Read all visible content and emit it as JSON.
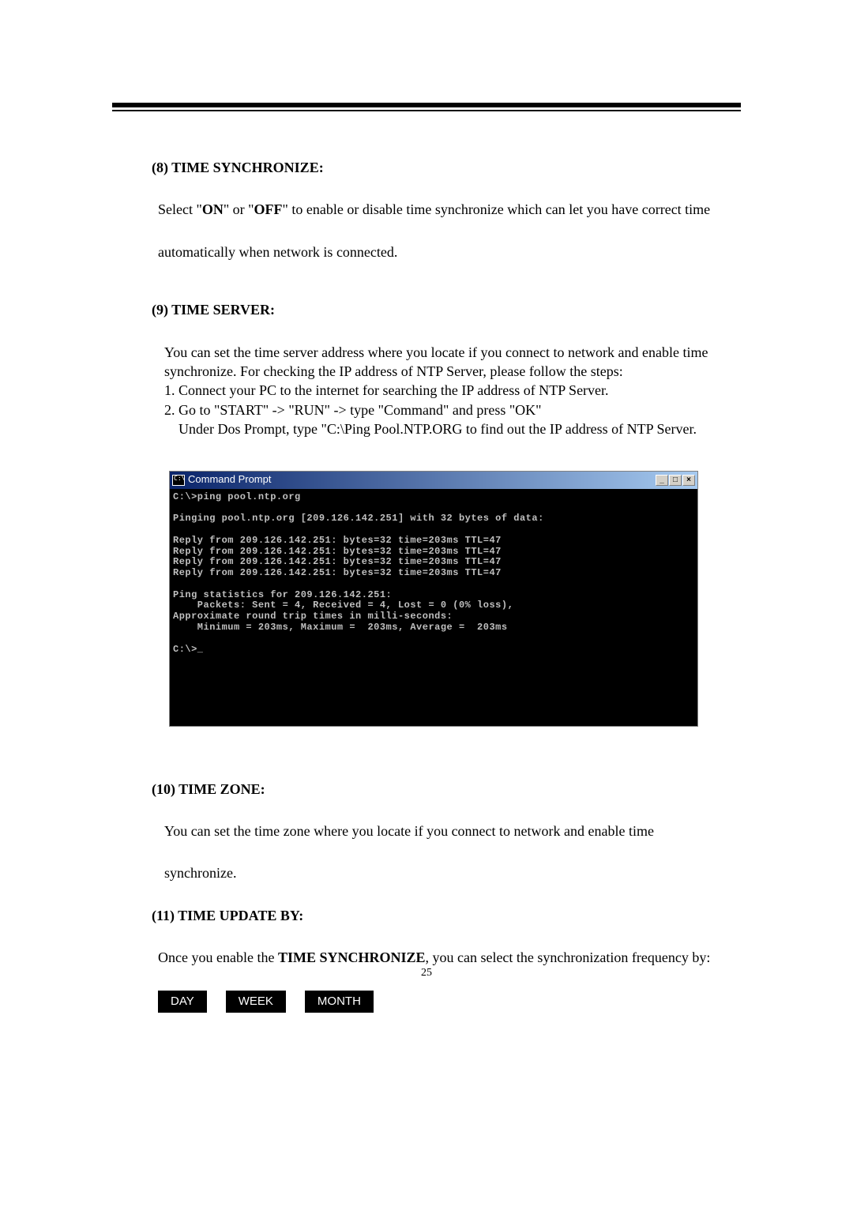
{
  "page_number": "25",
  "section8": {
    "heading": "(8) TIME SYNCHRONIZE:",
    "line1_pre": "Select \"",
    "on": "ON",
    "line1_mid": "\" or \"",
    "off": "OFF",
    "line1_post": "\" to enable or disable time synchronize which can let you have correct time",
    "line2": "automatically when network is connected."
  },
  "section9": {
    "heading": "(9) TIME SERVER:",
    "p1": "You can set the time server address where you locate if you connect to network and enable time",
    "p2": "synchronize. For checking the IP address of NTP Server, please follow the steps:",
    "step1": "1. Connect your PC to the internet for searching the IP address of NTP Server.",
    "step2": "2. Go to \"START\" -> \"RUN\" -> type \"Command\" and press \"OK\"",
    "step2b": "Under Dos Prompt, type \"C:\\Ping Pool.NTP.ORG to find out the IP address of  NTP Server."
  },
  "cmd": {
    "title": "Command Prompt",
    "btn_min": "_",
    "btn_max": "□",
    "btn_close": "×",
    "lines": "C:\\>ping pool.ntp.org\n\nPinging pool.ntp.org [209.126.142.251] with 32 bytes of data:\n\nReply from 209.126.142.251: bytes=32 time=203ms TTL=47\nReply from 209.126.142.251: bytes=32 time=203ms TTL=47\nReply from 209.126.142.251: bytes=32 time=203ms TTL=47\nReply from 209.126.142.251: bytes=32 time=203ms TTL=47\n\nPing statistics for 209.126.142.251:\n    Packets: Sent = 4, Received = 4, Lost = 0 (0% loss),\nApproximate round trip times in milli-seconds:\n    Minimum = 203ms, Maximum =  203ms, Average =  203ms\n\nC:\\>_\n\n\n\n\n\n\n"
  },
  "section10": {
    "heading": "(10) TIME ZONE:",
    "p1": "You can set the time zone where you locate if you connect to network and enable time",
    "p2": "synchronize."
  },
  "section11": {
    "heading": "(11) TIME UPDATE BY:",
    "p1_pre": "Once you enable the ",
    "p1_bold": "TIME SYNCHRONIZE",
    "p1_post": ", you can select the synchronization frequency by:",
    "btn_day": "DAY",
    "btn_week": "WEEK",
    "btn_month": "MONTH"
  }
}
